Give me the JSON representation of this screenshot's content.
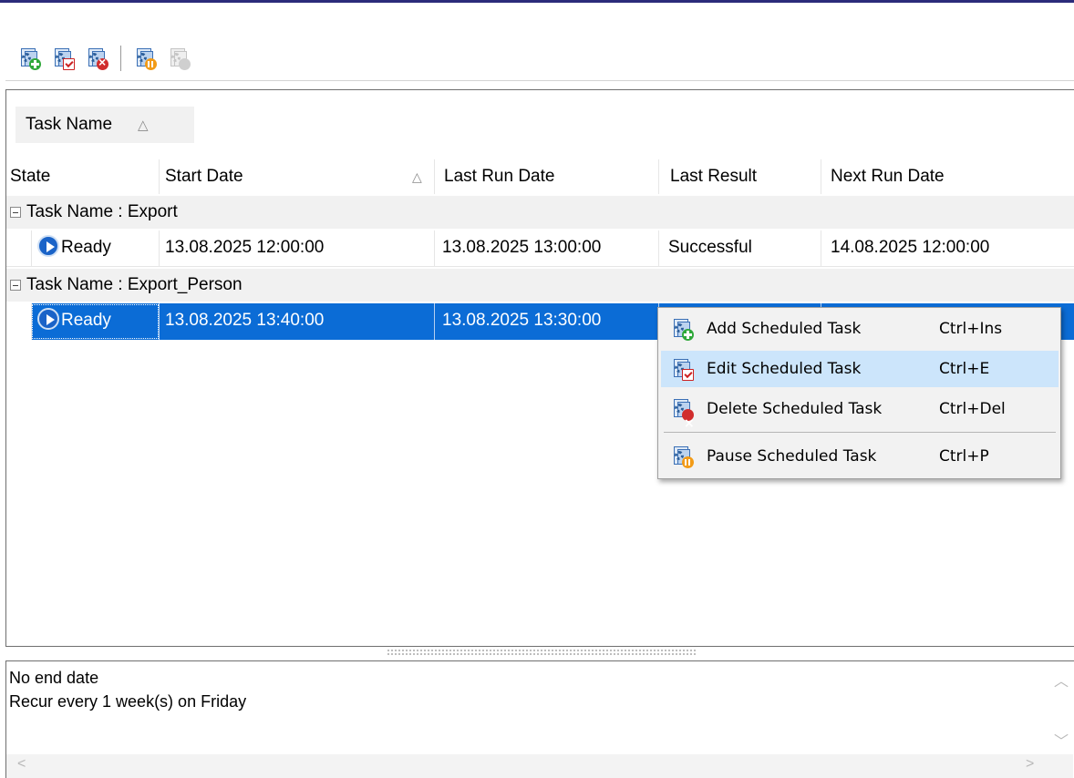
{
  "toolbar": {
    "buttons": [
      {
        "name": "add-scheduled-task",
        "icon": "task-add-icon"
      },
      {
        "name": "edit-scheduled-task",
        "icon": "task-edit-icon"
      },
      {
        "name": "delete-scheduled-task",
        "icon": "task-delete-icon"
      },
      {
        "name": "pause-scheduled-task",
        "icon": "task-pause-icon"
      },
      {
        "name": "resume-scheduled-task",
        "icon": "task-resume-icon",
        "disabled": true
      }
    ]
  },
  "grid": {
    "group_by": {
      "label": "Task Name",
      "sort": "ascending"
    },
    "columns": [
      "State",
      "Start Date",
      "Last Run Date",
      "Last Result",
      "Next Run Date"
    ],
    "sorted_column": "Start Date",
    "groups": [
      {
        "label": "Task Name : Export",
        "rows": [
          {
            "state": "Ready",
            "start_date": "13.08.2025 12:00:00",
            "last_run": "13.08.2025 13:00:00",
            "last_result": "Successful",
            "next_run": "14.08.2025 12:00:00"
          }
        ]
      },
      {
        "label": "Task Name : Export_Person",
        "rows": [
          {
            "state": "Ready",
            "start_date": "13.08.2025 13:40:00",
            "last_run": "13.08.2025 13:30:00",
            "last_result": "",
            "next_run": ""
          }
        ]
      }
    ]
  },
  "details": {
    "lines": [
      "No end date",
      "Recur every 1 week(s) on Friday"
    ]
  },
  "context_menu": {
    "items": [
      {
        "label": "Add Scheduled Task",
        "shortcut": "Ctrl+Ins",
        "icon": "task-add-icon"
      },
      {
        "label": "Edit Scheduled Task",
        "shortcut": "Ctrl+E",
        "icon": "task-edit-icon",
        "highlighted": true
      },
      {
        "label": "Delete Scheduled Task",
        "shortcut": "Ctrl+Del",
        "icon": "task-delete-icon"
      },
      {
        "label": "Pause Scheduled Task",
        "shortcut": "Ctrl+P",
        "icon": "task-pause-icon"
      }
    ]
  },
  "colors": {
    "selection": "#0b6cd6",
    "menu_highlight": "#cce5fb",
    "group_row": "#f1f1f1"
  }
}
